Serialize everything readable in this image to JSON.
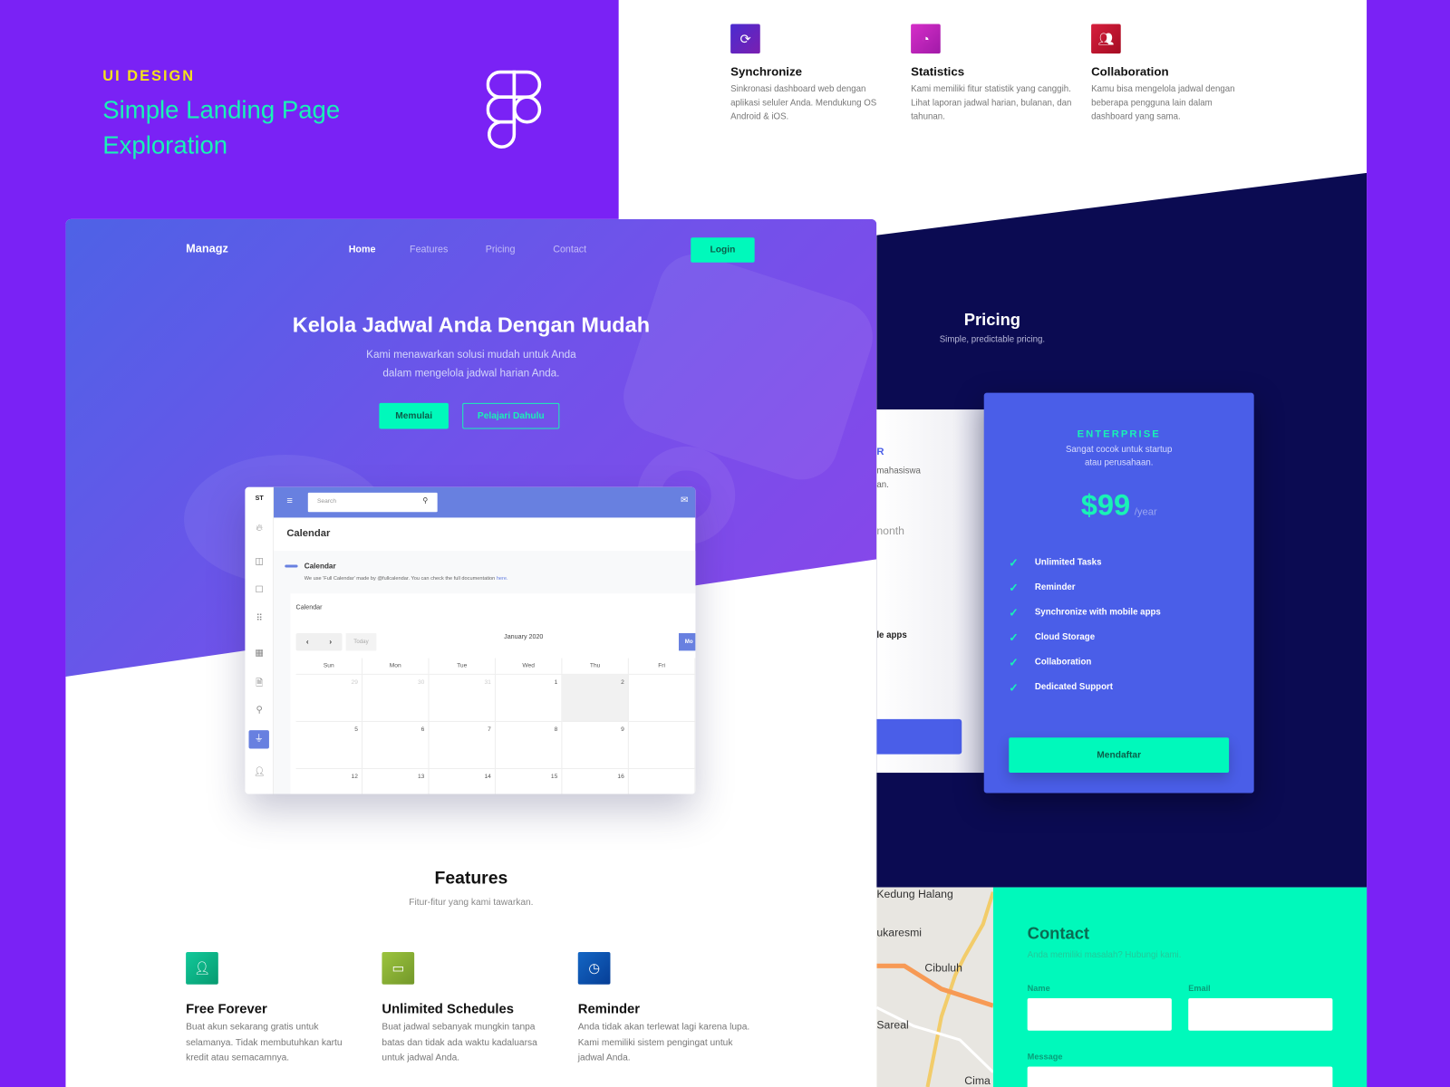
{
  "cover": {
    "tagline": "UI DESIGN",
    "headline": "Simple Landing Page Exploration",
    "logo": "figma-logo"
  },
  "top_features": [
    {
      "icon": "sync-icon",
      "title": "Synchronize",
      "desc": "Sinkronasi dashboard web dengan aplikasi seluler Anda. Mendukung OS Android & iOS.",
      "color": "#5a2bd0"
    },
    {
      "icon": "pie-chart-icon",
      "title": "Statistics",
      "desc": "Kami memiliki fitur statistik yang canggih. Lihat laporan jadwal harian, bulanan, dan tahunan.",
      "color": "#c22ac4"
    },
    {
      "icon": "users-icon",
      "title": "Collaboration",
      "desc": "Kamu bisa mengelola jadwal dengan beberapa pengguna lain dalam dashboard yang sama.",
      "color": "#c8102e"
    }
  ],
  "nav": {
    "brand": "Managz",
    "items": [
      "Home",
      "Features",
      "Pricing",
      "Contact"
    ],
    "login": "Login"
  },
  "hero": {
    "title": "Kelola Jadwal Anda Dengan Mudah",
    "subtitle_1": "Kami menawarkan solusi mudah untuk Anda",
    "subtitle_2": "dalam mengelola jadwal harian Anda.",
    "primary": "Memulai",
    "secondary": "Pelajari Dahulu"
  },
  "dashboard": {
    "brand": "ST",
    "search_placeholder": "Search",
    "page_title": "Calendar",
    "section_title": "Calendar",
    "section_desc": "We use 'Full Calendar' made by @fullcalendar. You can check the full documentation",
    "link": "here.",
    "card_title": "Calendar",
    "today": "Today",
    "month": "January 2020",
    "view_btn": "Mo",
    "days": [
      "Sun",
      "Mon",
      "Tue",
      "Wed",
      "Thu",
      "Fri"
    ],
    "weeks": [
      [
        "29",
        "30",
        "31",
        "1",
        "2",
        ""
      ],
      [
        "5",
        "6",
        "7",
        "8",
        "9",
        ""
      ],
      [
        "12",
        "13",
        "14",
        "15",
        "16",
        ""
      ]
    ]
  },
  "features": {
    "title": "Features",
    "subtitle": "Fitur-fitur yang kami tawarkan.",
    "items": [
      {
        "icon": "user-plus-icon",
        "title": "Free Forever",
        "desc": "Buat akun sekarang gratis untuk selamanya. Tidak membutuhkan kartu kredit atau semacamnya.",
        "color": "#0bb98a"
      },
      {
        "icon": "calendar-icon",
        "title": "Unlimited Schedules",
        "desc": "Buat jadwal sebanyak mungkin tanpa batas dan tidak ada waktu kadaluarsa untuk jadwal Anda.",
        "color": "#8cb637"
      },
      {
        "icon": "clock-icon",
        "title": "Reminder",
        "desc": "Anda tidak akan terlewat lagi karena lupa. Kami memiliki sistem pengingat untuk jadwal Anda.",
        "color": "#0d55b0"
      }
    ]
  },
  "pricing": {
    "title": "Pricing",
    "subtitle": "Simple, predictable pricing.",
    "partial": {
      "name_fragment": "R",
      "desc_1": "mahasiswa",
      "desc_2": "an.",
      "price_fragment": "nonth",
      "feature_fragment": "le apps"
    },
    "enterprise": {
      "name": "ENTERPRISE",
      "desc_1": "Sangat cocok untuk startup",
      "desc_2": "atau perusahaan.",
      "price": "$99",
      "period": "/year",
      "features": [
        "Unlimited Tasks",
        "Reminder",
        "Synchronize with mobile apps",
        "Cloud Storage",
        "Collaboration",
        "Dedicated Support"
      ],
      "cta": "Mendaftar"
    }
  },
  "map": {
    "places": [
      "Kedung Halang",
      "ukaresmi",
      "Cibuluh",
      "Sareal",
      "Cima"
    ]
  },
  "contact": {
    "title": "Contact",
    "subtitle": "Anda memiliki masalah? Hubungi kami.",
    "name_label": "Name",
    "email_label": "Email",
    "message_label": "Message"
  },
  "colors": {
    "purple": "#7a22f5",
    "navy": "#0b0b52",
    "accent": "#00f9bb",
    "blue": "#4a5ee8"
  }
}
